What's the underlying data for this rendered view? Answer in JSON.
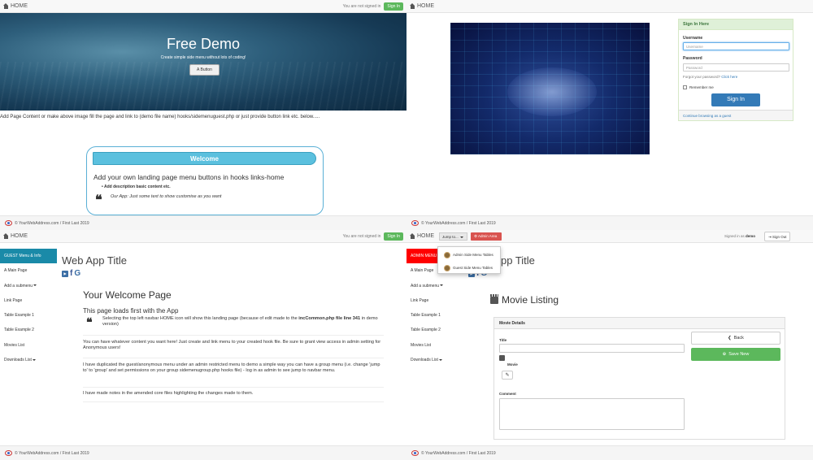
{
  "q1": {
    "nav": {
      "home": "HOME",
      "status": "You are not signed in",
      "signin": "Sign In"
    },
    "hero": {
      "title": "Free Demo",
      "subtitle": "Create simple side menu without lots of coding!",
      "button": "A Button"
    },
    "content_text": "Add Page Content or make above image fill the page and link to (demo file name) hooks/sidemenuguest.php or just provide button link etc. below.....",
    "welcome": {
      "bar": "Welcome",
      "heading": "Add your own landing page menu buttons in hooks links-home",
      "bullet": "Add description basic content etc.",
      "quote": "Our App: Just some text to show customise as you want"
    },
    "footer": "© YourWebAddress.com / First Last 2019"
  },
  "q2": {
    "nav": {
      "home": "HOME"
    },
    "login": {
      "header": "Sign In Here",
      "username_label": "Username",
      "username_placeholder": "Username",
      "password_label": "Password",
      "password_placeholder": "Password",
      "forgot": "Forgot your password?",
      "forgot_link": "Click here",
      "remember": "Remember me",
      "signin": "Sign In",
      "guest": "Continue browsing as a guest"
    }
  },
  "q3": {
    "nav": {
      "home": "HOME",
      "status": "You are not signed in",
      "signin": "Sign In"
    },
    "sidebar": [
      {
        "label": "GUEST Menu & Info"
      },
      {
        "label": "A Main Page"
      },
      {
        "label": "Add a submenu"
      },
      {
        "label": "Link Page"
      },
      {
        "label": "Table Example 1"
      },
      {
        "label": "Table Example 2"
      },
      {
        "label": "Movies List"
      },
      {
        "label": "Downloads List"
      }
    ],
    "app_title": "Web App Title",
    "page_title": "Your Welcome Page",
    "loads_first": "This page loads first with the App",
    "quote_pre": "Selecting the top left navbar HOME icon will show this landing page (because of edit made to the ",
    "quote_bold": "incCommon.php file line 341",
    "quote_post": " in demo version)",
    "para1": "You can have whatever content you want here! Just create and link menu to your created hook file. Be sure to grant view access in admin setting for Anonymous users!",
    "para2": "I have duplicated the guest/anonymous menu under an admin restricted menu to demo a simple way you can have a group menu (i.e. change 'jump to' to 'group' and set permissions on your group sidemenugroup.php hooks file) - log in as admin to see jump to navbar menu.",
    "para3": "I have made notes in the amended core files highlighting the changes made to them.",
    "footer": "© YourWebAddress.com / First Last 2019"
  },
  "q4": {
    "nav": {
      "home": "HOME",
      "jump": "Jump to...",
      "admin": "Admin Area",
      "signed_pre": "Signed in as",
      "signed_user": "demo",
      "signout": "Sign Out"
    },
    "dropdown": [
      "Admin Side Menu Tables",
      "Guest Side Menu Tables"
    ],
    "sidebar": [
      {
        "label": "ADMIN MENU"
      },
      {
        "label": "A Main Page"
      },
      {
        "label": "Add a submenu"
      },
      {
        "label": "Link Page"
      },
      {
        "label": "Table Example 1"
      },
      {
        "label": "Table Example 2"
      },
      {
        "label": "Movies List"
      },
      {
        "label": "Downloads List"
      }
    ],
    "app_title_partial": "pp Title",
    "listing_title": "Movie Listing",
    "panel": {
      "header": "Movie Details",
      "title_label": "Title",
      "movie_label": "Movie",
      "comment_label": "Comment",
      "back": "Back",
      "save": "Save New"
    },
    "footer": "© YourWebAddress.com / First Last 2019",
    "footer_top": "© YourWebAddress.com / First Last 2019"
  },
  "colors": {
    "green": "#5cb85c",
    "blue": "#337ab7",
    "teal": "#1a8aa8",
    "red": "#ff0000",
    "welcome": "#5bc0de"
  }
}
